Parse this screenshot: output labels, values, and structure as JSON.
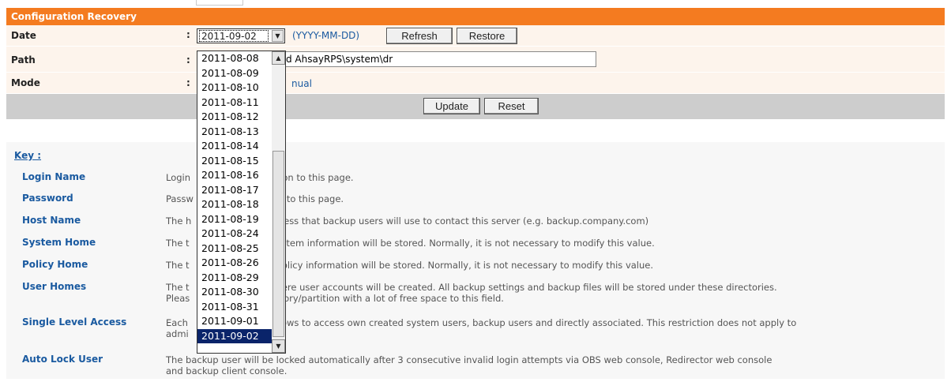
{
  "panel": {
    "title": "Configuration Recovery",
    "date": {
      "label": "Date",
      "colon": ":",
      "selected": "2011-09-02",
      "format_hint": "(YYYY-MM-DD)",
      "refresh_label": "Refresh",
      "restore_label": "Restore"
    },
    "path": {
      "label": "Path",
      "colon": ":",
      "value": "d AhsayRPS\\system\\dr"
    },
    "mode": {
      "label": "Mode",
      "colon": ":",
      "value": "nual"
    },
    "update_label": "Update",
    "reset_label": "Reset"
  },
  "dropdown": {
    "options": [
      "2011-08-08",
      "2011-08-09",
      "2011-08-10",
      "2011-08-11",
      "2011-08-12",
      "2011-08-13",
      "2011-08-14",
      "2011-08-15",
      "2011-08-16",
      "2011-08-17",
      "2011-08-18",
      "2011-08-19",
      "2011-08-24",
      "2011-08-25",
      "2011-08-26",
      "2011-08-29",
      "2011-08-30",
      "2011-08-31",
      "2011-09-01",
      "2011-09-02"
    ],
    "selected_index": 19
  },
  "key": {
    "title": "Key :",
    "entries": [
      {
        "name": "Login Name",
        "desc_left": "Login",
        "desc_right": "ogon to this page."
      },
      {
        "name": "Password",
        "desc_left": "Passw",
        "desc_right": "on to this page."
      },
      {
        "name": "Host Name",
        "desc_left": "The h",
        "desc_right": "dress that backup users will use to contact this server (e.g. backup.company.com)"
      },
      {
        "name": "System Home",
        "desc_left": "The t",
        "desc_right": "ystem information will be stored. Normally, it is not necessary to modify this value."
      },
      {
        "name": "Policy Home",
        "desc_left": "The t",
        "desc_right": "policy information will be stored. Normally, it is not necessary to modify this value."
      },
      {
        "name": "User Homes",
        "desc_left": "The t",
        "desc_right": "here user accounts will be created. All backup settings and backup files will be stored under these directories.",
        "desc_left2": "Pleas",
        "desc_right2": "ctory/partition with a lot of free space to this field."
      },
      {
        "name": "Single Level Access",
        "desc_left": "Each",
        "desc_right": "ows to access own created system users, backup users and directly associated. This restriction does not apply to",
        "desc_left2": "admi",
        "desc_right2": ""
      },
      {
        "name": "Auto Lock User",
        "desc_left": "The backup user will be locked automatically after 3 consecutive invalid login attempts via OBS web console, Redirector web console",
        "desc_right": "",
        "desc_left2": "and backup client console.",
        "desc_right2": ""
      }
    ]
  },
  "colors": {
    "title_bar": "#f47b20",
    "row_bg": "#fdf4ec",
    "link_blue": "#1a5aa0",
    "selection": "#0a246a",
    "action_bar": "#cdcdcd"
  }
}
